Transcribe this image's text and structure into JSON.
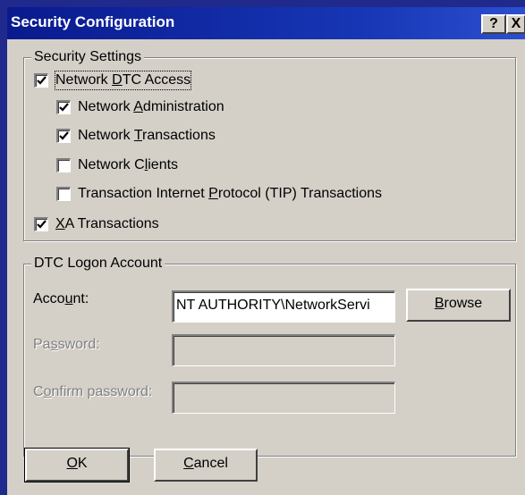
{
  "window": {
    "title": "Security Configuration",
    "help_button": "?",
    "close_button": "X"
  },
  "security_settings": {
    "legend": "Security Settings",
    "items": [
      {
        "label": "Network DTC Access",
        "checked": true
      },
      {
        "label": "Network Administration",
        "checked": true
      },
      {
        "label": "Network Transactions",
        "checked": true
      },
      {
        "label": "Network Clients",
        "checked": false
      },
      {
        "label": "Transaction Internet Protocol (TIP) Transactions",
        "checked": false
      },
      {
        "label": "XA Transactions",
        "checked": true
      }
    ]
  },
  "logon_account": {
    "legend": "DTC Logon Account",
    "account_label": "Account:",
    "account_value": "NT AUTHORITY\\NetworkServi",
    "browse_label": "Browse",
    "password_label": "Password:",
    "password_value": "",
    "confirm_label": "Confirm password:",
    "confirm_value": ""
  },
  "footer": {
    "ok_label": "OK",
    "cancel_label": "Cancel"
  },
  "colors": {
    "desktop": "#1f2a8c",
    "titlebar": "#0a1a8e",
    "face": "#d4d0c8"
  }
}
